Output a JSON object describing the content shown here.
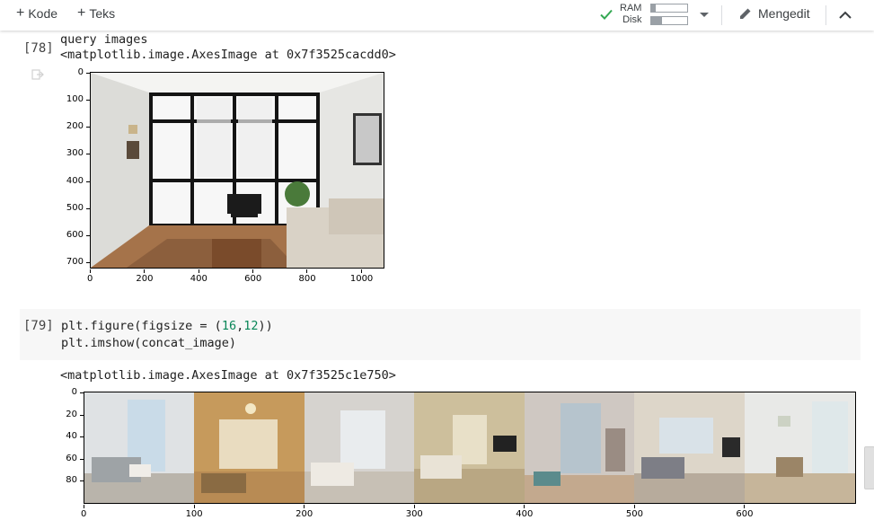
{
  "toolbar": {
    "code_label": "Kode",
    "text_label": "Teks",
    "ram_label": "RAM",
    "disk_label": "Disk",
    "ram_fraction": 0.12,
    "disk_fraction": 0.3,
    "editing_label": "Mengedit"
  },
  "cells": [
    {
      "prompt": "[78]",
      "code": "query images",
      "output": "<matplotlib.image.AxesImage at 0x7f3525cacdd0>",
      "plot": {
        "x_ticks": [
          "0",
          "200",
          "400",
          "600",
          "800",
          "1000"
        ],
        "y_ticks": [
          "0",
          "100",
          "200",
          "300",
          "400",
          "500",
          "600",
          "700"
        ]
      }
    },
    {
      "prompt": "[79]",
      "code_line1_a": "plt.figure(figsize = (",
      "code_line1_n1": "16",
      "code_line1_c": ",",
      "code_line1_n2": "12",
      "code_line1_b": "))",
      "code_line2": "plt.imshow(concat_image)",
      "output": "<matplotlib.image.AxesImage at 0x7f3525c1e750>",
      "plot": {
        "x_ticks": [
          "0",
          "100",
          "200",
          "300",
          "400",
          "500",
          "600"
        ],
        "y_ticks": [
          "0",
          "20",
          "40",
          "60",
          "80"
        ]
      }
    }
  ],
  "colors": {
    "accent_check": "#34a853"
  }
}
